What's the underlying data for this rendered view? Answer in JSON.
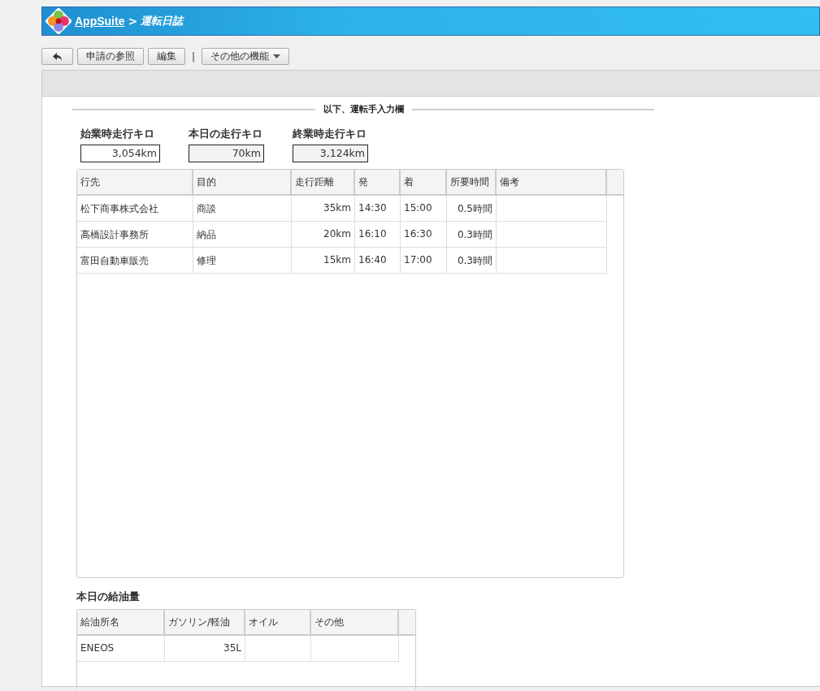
{
  "header": {
    "app": "AppSuite",
    "separator": ">",
    "page": "運転日誌"
  },
  "toolbar": [
    {
      "kind": "back"
    },
    {
      "kind": "button",
      "label": "申請の参照"
    },
    {
      "kind": "button",
      "label": "編集"
    },
    {
      "kind": "separator",
      "label": "|"
    },
    {
      "kind": "menu",
      "label": "その他の機能"
    }
  ],
  "section_title": "以下、運転手入力欄",
  "odometer": [
    {
      "label": "始業時走行キロ",
      "value": "3,054km",
      "readonly": false
    },
    {
      "label": "本日の走行キロ",
      "value": "70km",
      "readonly": true
    },
    {
      "label": "終業時走行キロ",
      "value": "3,124km",
      "readonly": true
    }
  ],
  "trips": {
    "columns": [
      {
        "label": "行先",
        "numeric": false
      },
      {
        "label": "目的",
        "numeric": false
      },
      {
        "label": "走行距離",
        "numeric": true
      },
      {
        "label": "発",
        "numeric": false
      },
      {
        "label": "着",
        "numeric": false
      },
      {
        "label": "所要時間",
        "numeric": true
      },
      {
        "label": "備考"
      }
    ],
    "rows": [
      [
        "松下商事株式会社",
        "商談",
        "35km",
        "14:30",
        "15:00",
        "0.5時間",
        ""
      ],
      [
        "高橋設計事務所",
        "納品",
        "20km",
        "16:10",
        "16:30",
        "0.3時間",
        ""
      ],
      [
        "富田自動車販売",
        "修理",
        "15km",
        "16:40",
        "17:00",
        "0.3時間",
        ""
      ]
    ]
  },
  "fuel": {
    "title": "本日の給油量",
    "columns": [
      {
        "label": "給油所名",
        "numeric": false
      },
      {
        "label": "ガソリン/軽油",
        "numeric": true
      },
      {
        "label": "オイル"
      },
      {
        "label": "その他"
      }
    ],
    "rows": [
      [
        "ENEOS",
        "35L",
        "",
        ""
      ]
    ]
  }
}
